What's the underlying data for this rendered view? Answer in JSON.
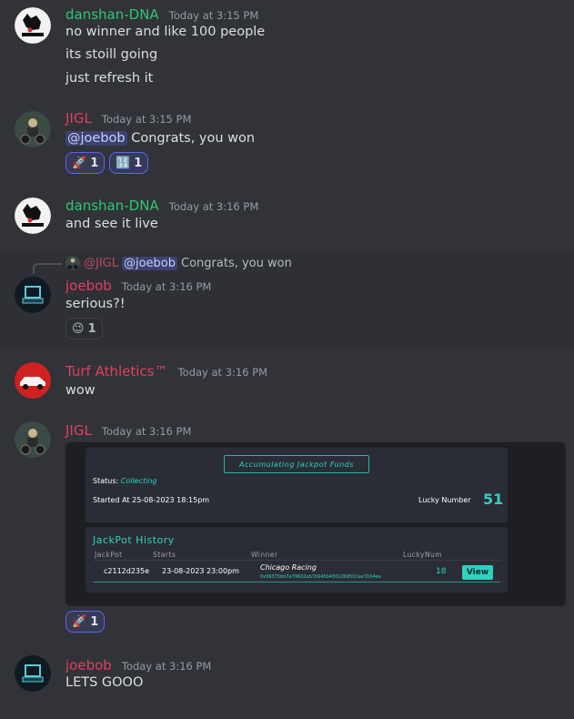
{
  "messages": [
    {
      "user": "danshan-DNA",
      "color": "#2dc770",
      "time": "Today at 3:15 PM",
      "lines": [
        "no winner and like 100 people",
        "its stoill going",
        "just refresh it"
      ]
    },
    {
      "user": "JIGL",
      "color": "#e23f5f",
      "time": "Today at 3:15 PM",
      "mention": "@joebob",
      "text": "Congrats, you won",
      "reactions": [
        {
          "emoji": "rocket",
          "count": "1"
        },
        {
          "emoji": "numbers",
          "count": "1"
        }
      ]
    },
    {
      "user": "danshan-DNA",
      "color": "#2dc770",
      "time": "Today at 3:16 PM",
      "text": "and see it live"
    },
    {
      "reply": {
        "user": "@JIGL",
        "mention": "@joebob",
        "text": "Congrats, you won"
      },
      "user": "joebob",
      "color": "#e23f5f",
      "time": "Today at 3:16 PM",
      "text": "serious?!",
      "reactions": [
        {
          "emoji": "wink",
          "count": "1"
        }
      ]
    },
    {
      "user": "Turf Athletics™",
      "color": "#e23f5f",
      "time": "Today at 3:16 PM",
      "text": "wow"
    },
    {
      "user": "JIGL",
      "color": "#e23f5f",
      "time": "Today at 3:16 PM",
      "reactions": [
        {
          "emoji": "rocket",
          "count": "1"
        }
      ]
    },
    {
      "user": "joebob",
      "color": "#e23f5f",
      "time": "Today at 3:16 PM",
      "text": "LETS GOOO"
    }
  ],
  "jackpot": {
    "button": "Accumulating Jackpot Funds",
    "status_label": "Status:",
    "status_value": "Collecting",
    "started_label": "Started At 25-08-2023 18:15pm",
    "lucky_label": "Lucky Number",
    "lucky_value": "51",
    "history_title": "JackPot History",
    "columns": [
      "JackPot",
      "Starts",
      "Winner",
      "LuckyNum"
    ],
    "row": {
      "jackpot": "c2112d235e",
      "starts": "23-08-2023 23:00pm",
      "winner": "Chicago Racing",
      "address": "0x96375bb7e79602ab7b945b4301068501ae3104ee",
      "lucky": "18",
      "action": "View"
    }
  },
  "icons": {
    "rocket": "🚀",
    "numbers": "🔢",
    "wink": "😉"
  }
}
